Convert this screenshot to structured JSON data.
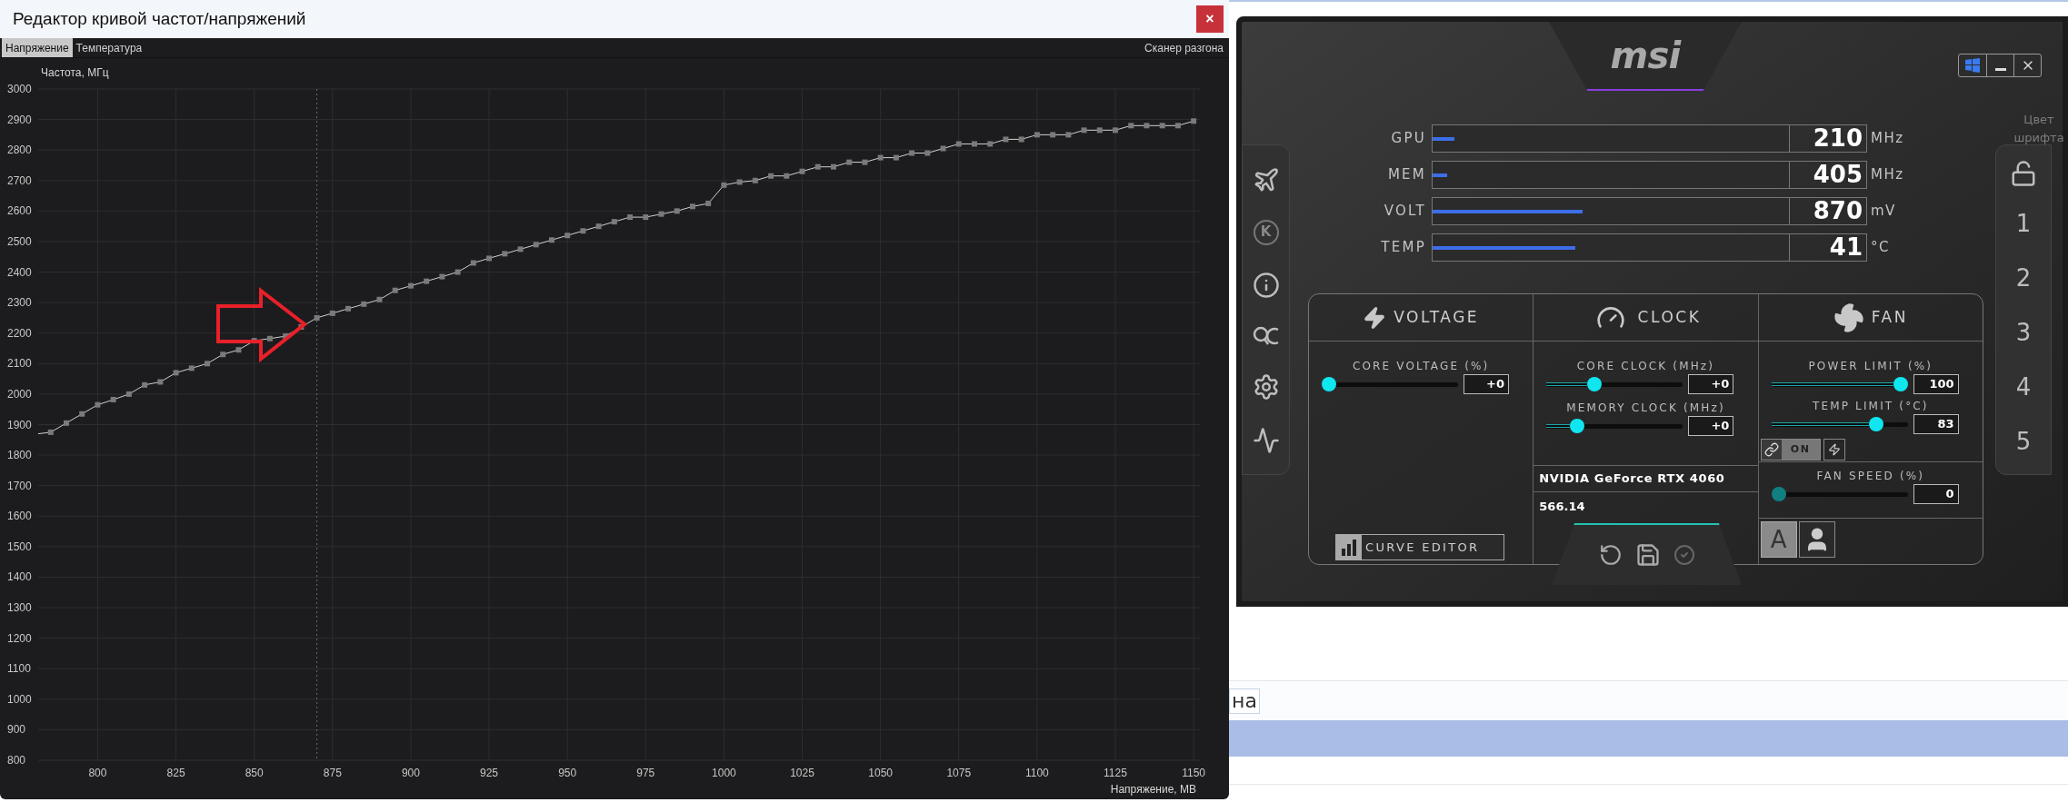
{
  "curve_editor": {
    "title": "Редактор кривой частот/напряжений",
    "close_label": "×",
    "tabs": [
      {
        "label": "Напряжение",
        "selected": true
      },
      {
        "label": "Температура",
        "selected": false
      }
    ],
    "scanner_label": "Сканер разгона",
    "chart_data": {
      "type": "line",
      "xlabel": "Напряжение, МВ",
      "ylabel": "Частота, МГц",
      "x": [
        781,
        785,
        790,
        795,
        800,
        805,
        810,
        815,
        820,
        825,
        830,
        835,
        840,
        845,
        850,
        855,
        860,
        865,
        870,
        875,
        880,
        885,
        890,
        895,
        900,
        905,
        910,
        915,
        920,
        925,
        930,
        935,
        940,
        945,
        950,
        955,
        960,
        965,
        970,
        975,
        980,
        985,
        990,
        995,
        1000,
        1005,
        1010,
        1015,
        1020,
        1025,
        1030,
        1035,
        1040,
        1045,
        1050,
        1055,
        1060,
        1065,
        1070,
        1075,
        1080,
        1085,
        1090,
        1095,
        1100,
        1105,
        1110,
        1115,
        1120,
        1125,
        1130,
        1135,
        1140,
        1145,
        1150
      ],
      "series": [
        {
          "color": "#d0d0d0",
          "marker": "square",
          "values": [
            1870,
            1875,
            1905,
            1935,
            1965,
            1982,
            2000,
            2030,
            2040,
            2070,
            2085,
            2100,
            2130,
            2145,
            2175,
            2182,
            2190,
            2220,
            2250,
            2265,
            2280,
            2295,
            2310,
            2340,
            2355,
            2370,
            2385,
            2400,
            2430,
            2445,
            2460,
            2475,
            2490,
            2505,
            2520,
            2535,
            2550,
            2565,
            2580,
            2580,
            2590,
            2600,
            2615,
            2625,
            2685,
            2695,
            2700,
            2715,
            2715,
            2730,
            2745,
            2745,
            2760,
            2760,
            2775,
            2775,
            2790,
            2790,
            2805,
            2820,
            2820,
            2820,
            2835,
            2835,
            2850,
            2850,
            2850,
            2865,
            2865,
            2865,
            2880,
            2880,
            2880,
            2880,
            2895
          ]
        }
      ],
      "xlim": [
        781,
        1152
      ],
      "ylim": [
        800,
        3000
      ],
      "xticks": [
        800,
        825,
        850,
        875,
        900,
        925,
        950,
        975,
        1000,
        1025,
        1050,
        1075,
        1100,
        1125,
        1150
      ],
      "yticks": [
        800,
        900,
        1000,
        1100,
        1200,
        1300,
        1400,
        1500,
        1600,
        1700,
        1800,
        1900,
        2000,
        2100,
        2200,
        2300,
        2400,
        2500,
        2600,
        2700,
        2800,
        2900,
        3000
      ],
      "grid": true,
      "ref_lines": [
        {
          "axis": "x",
          "value": 870
        }
      ]
    }
  },
  "afterburner": {
    "brand": "msi",
    "monitors": [
      {
        "label": "GPU",
        "value": "210",
        "unit": "MHz",
        "level": 0.06
      },
      {
        "label": "MEM",
        "value": "405",
        "unit": "MHz",
        "level": 0.04
      },
      {
        "label": "VOLT",
        "value": "870",
        "unit": "mV",
        "level": 0.42
      },
      {
        "label": "TEMP",
        "value": "41",
        "unit": "°C",
        "level": 0.4
      }
    ],
    "left_tools": [
      {
        "kind": "jet"
      },
      {
        "kind": "letter",
        "glyph": "K"
      },
      {
        "kind": "info"
      },
      {
        "kind": "oc"
      },
      {
        "kind": "settings"
      },
      {
        "kind": "monitor"
      }
    ],
    "profiles": [
      {
        "label": "1"
      },
      {
        "label": "2"
      },
      {
        "label": "3"
      },
      {
        "label": "4"
      },
      {
        "label": "5"
      }
    ],
    "sections": [
      {
        "kind": "voltage",
        "title": "VOLTAGE"
      },
      {
        "kind": "clock",
        "title": "CLOCK"
      },
      {
        "kind": "fan",
        "title": "FAN"
      }
    ],
    "voltage_controls": [
      {
        "label": "CORE VOLTAGE (%)",
        "value": "+0",
        "level": 0
      }
    ],
    "curve_editor_button": "CURVE EDITOR",
    "clock_controls": [
      {
        "label": "CORE CLOCK (MHz)",
        "value": "+0",
        "level": 0.33
      },
      {
        "label": "MEMORY CLOCK (MHz)",
        "value": "+0",
        "level": 0.19
      }
    ],
    "gpu_name": "NVIDIA GeForce RTX 4060",
    "driver": "566.14",
    "limit_controls": [
      {
        "label": "POWER LIMIT (%)",
        "value": "100",
        "level": 1
      },
      {
        "label": "TEMP LIMIT (°C)",
        "value": "83",
        "level": 0.8
      }
    ],
    "link_label": "ON",
    "fan_speed": {
      "label": "FAN SPEED (%)",
      "value": "0",
      "level": 0,
      "disabled": true
    },
    "fan_modes": [
      {
        "kind": "auto",
        "label": "A",
        "selected": true
      },
      {
        "kind": "user",
        "selected": false
      }
    ]
  },
  "page": {
    "font_color_label": "Цвет шрифта",
    "tag_text": "на"
  }
}
